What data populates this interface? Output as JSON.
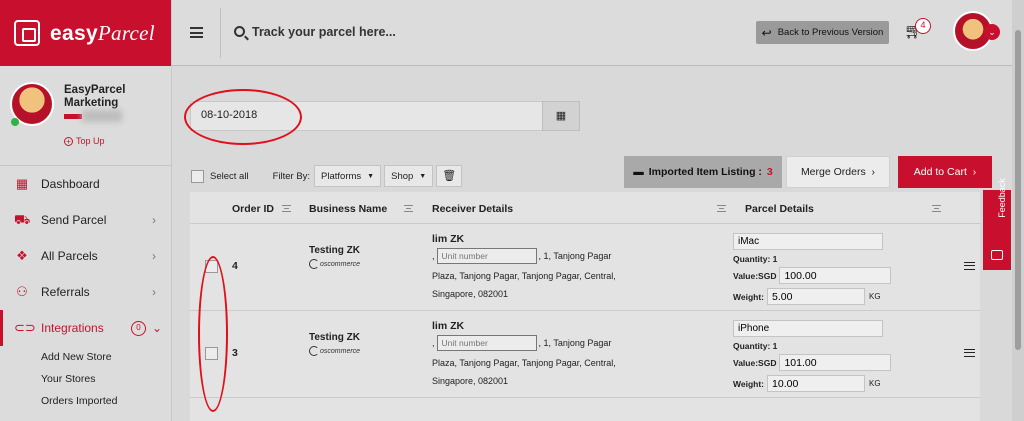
{
  "brand": {
    "logo_main": "easy",
    "logo_sub": "Parcel"
  },
  "profile": {
    "name": "EasyParcel Marketing",
    "topup_label": "Top Up"
  },
  "sidebar": {
    "items": [
      {
        "label": "Dashboard",
        "icon": "dashboard-icon",
        "has_chevron": false
      },
      {
        "label": "Send Parcel",
        "icon": "truck-icon",
        "has_chevron": true
      },
      {
        "label": "All Parcels",
        "icon": "boxes-icon",
        "has_chevron": true
      },
      {
        "label": "Referrals",
        "icon": "users-icon",
        "has_chevron": true
      },
      {
        "label": "Integrations",
        "icon": "link-icon",
        "badge": "0",
        "active": true
      }
    ],
    "subitems": [
      "Add New Store",
      "Your Stores",
      "Orders Imported"
    ]
  },
  "header": {
    "search_placeholder": "Track your parcel here...",
    "back_button": "Back to Previous Version",
    "cart_count": "4"
  },
  "filters": {
    "date_value": "08-10-2018",
    "select_all": "Select all",
    "filter_by": "Filter By:",
    "platform_dropdown": "Platforms",
    "shop_dropdown": "Shop"
  },
  "actions": {
    "listing_label": "Imported Item Listing :",
    "listing_count": "3",
    "merge_orders": "Merge Orders",
    "add_to_cart": "Add to Cart"
  },
  "table": {
    "headers": [
      "Order ID",
      "Business Name",
      "Receiver Details",
      "Parcel Details"
    ],
    "rows": [
      {
        "order_id": "4",
        "business": "Testing ZK",
        "platform": "oscommerce",
        "receiver": "lim ZK",
        "unit_placeholder": "Unit number",
        "address_1": ", 1, Tanjong Pagar",
        "address_2": "Plaza, Tanjong Pagar, Tanjong Pagar, Central,",
        "address_3": "Singapore, 082001",
        "item": "iMac",
        "quantity": "Quantity: 1",
        "value_label": "Value:SGD",
        "value": "100.00",
        "weight_label": "Weight:",
        "weight": "5.00",
        "weight_unit": "KG"
      },
      {
        "order_id": "3",
        "business": "Testing ZK",
        "platform": "oscommerce",
        "receiver": "lim ZK",
        "unit_placeholder": "Unit number",
        "address_1": ", 1, Tanjong Pagar",
        "address_2": "Plaza, Tanjong Pagar, Tanjong Pagar, Central,",
        "address_3": "Singapore, 082001",
        "item": "iPhone",
        "quantity": "Quantity: 1",
        "value_label": "Value:SGD",
        "value": "101.00",
        "weight_label": "Weight:",
        "weight": "10.00",
        "weight_unit": "KG"
      }
    ]
  },
  "feedback": {
    "label": "Feedback"
  },
  "colors": {
    "brand_red": "#c8102e",
    "annotation_red": "#e0101a"
  }
}
